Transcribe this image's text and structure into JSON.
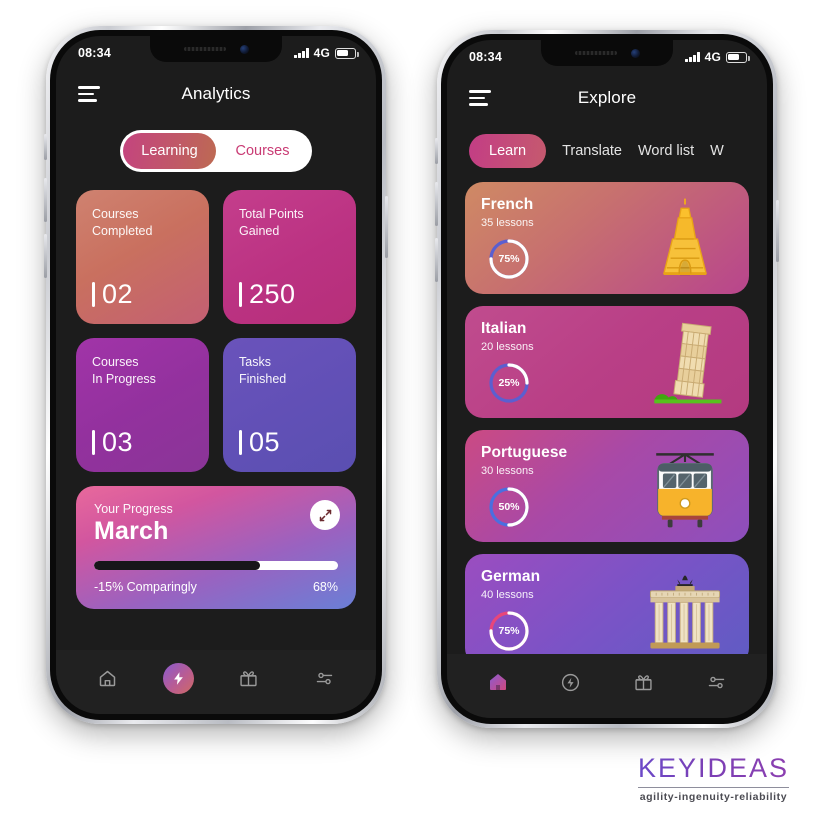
{
  "brand": {
    "name": "KEYIDEAS",
    "tagline": "agility-ingenuity-reliability"
  },
  "phone_left": {
    "status": {
      "time": "08:34",
      "network": "4G",
      "signal_icon": "signal-bars-icon",
      "battery_icon": "battery-icon"
    },
    "header": {
      "menu_icon": "hamburger-menu-icon",
      "title": "Analytics"
    },
    "segmented": {
      "options": [
        {
          "label": "Learning",
          "active": true
        },
        {
          "label": "Courses",
          "active": false
        }
      ]
    },
    "stats": [
      {
        "label_line1": "Courses",
        "label_line2": "Completed",
        "value": "02",
        "color": "#c9705f"
      },
      {
        "label_line1": "Total Points",
        "label_line2": "Gained",
        "value": "250",
        "color": "#bb3282"
      },
      {
        "label_line1": "Courses",
        "label_line2": "In Progress",
        "value": "03",
        "color": "#93319e"
      },
      {
        "label_line1": "Tasks",
        "label_line2": "Finished",
        "value": "05",
        "color": "#6150b6"
      }
    ],
    "progress": {
      "label": "Your Progress",
      "month": "March",
      "comparison": "-15% Comparingly",
      "percent_label": "68%",
      "percent_value": 68,
      "expand_icon": "expand-icon"
    },
    "bottom_nav": [
      {
        "icon": "home-icon",
        "active": false
      },
      {
        "icon": "lightning-icon",
        "active": true
      },
      {
        "icon": "gift-icon",
        "active": false
      },
      {
        "icon": "sliders-icon",
        "active": false
      }
    ]
  },
  "phone_right": {
    "status": {
      "time": "08:34",
      "network": "4G",
      "signal_icon": "signal-bars-icon",
      "battery_icon": "battery-icon"
    },
    "header": {
      "menu_icon": "hamburger-menu-icon",
      "title": "Explore"
    },
    "tabs": [
      {
        "label": "Learn",
        "active": true
      },
      {
        "label": "Translate",
        "active": false
      },
      {
        "label": "Word list",
        "active": false
      },
      {
        "label": "W",
        "active": false
      }
    ],
    "languages": [
      {
        "name": "French",
        "lessons": "35 lessons",
        "percent_label": "75%",
        "percent_value": 75,
        "art_icon": "eiffel-tower-icon",
        "arc_color": "#5b5fd0"
      },
      {
        "name": "Italian",
        "lessons": "20 lessons",
        "percent_label": "25%",
        "percent_value": 25,
        "art_icon": "leaning-tower-pisa-icon",
        "arc_color": "#5b5fd0"
      },
      {
        "name": "Portuguese",
        "lessons": "30 lessons",
        "percent_label": "50%",
        "percent_value": 50,
        "art_icon": "tram-icon",
        "arc_color": "#4a6fe0"
      },
      {
        "name": "German",
        "lessons": "40 lessons",
        "percent_label": "75%",
        "percent_value": 75,
        "art_icon": "brandenburg-gate-icon",
        "arc_color": "#e8467a"
      }
    ],
    "bottom_nav": [
      {
        "icon": "home-icon",
        "active": true
      },
      {
        "icon": "lightning-icon",
        "active": false
      },
      {
        "icon": "gift-icon",
        "active": false
      },
      {
        "icon": "sliders-icon",
        "active": false
      }
    ]
  }
}
